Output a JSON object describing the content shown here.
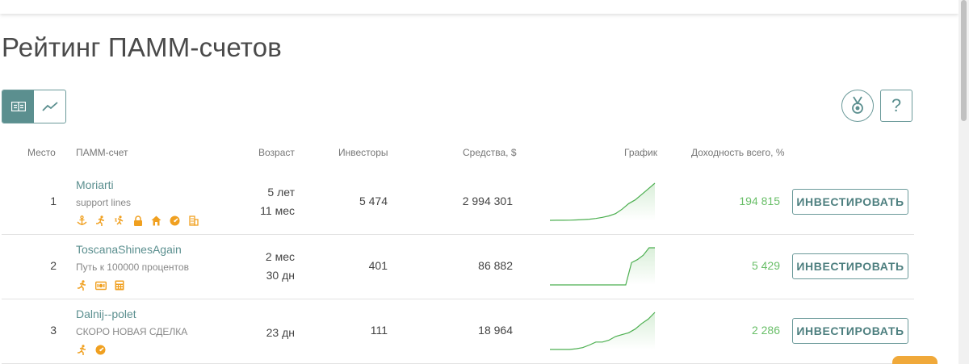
{
  "page": {
    "title": "Рейтинг ПАММ-счетов"
  },
  "controls": {
    "table_view_icon": "table-icon",
    "chart_view_icon": "trend-chart-icon",
    "medal_icon": "medal-icon",
    "help_label": "?"
  },
  "table": {
    "headers": {
      "rank": "Место",
      "account": "ПАММ-счет",
      "age": "Возраст",
      "investors": "Инвесторы",
      "funds": "Средства, $",
      "chart": "График",
      "yield": "Доходность всего, %"
    },
    "rows": [
      {
        "rank": "1",
        "name": "Moriarti",
        "subtitle": "support lines",
        "age_line1": "5 лет",
        "age_line2": "11 мес",
        "investors": "5 474",
        "funds": "2 994 301",
        "yield": "194 815",
        "invest_label": "ИНВЕСТИРОВАТЬ",
        "icons": [
          "anchor-icon",
          "runner-icon",
          "lightning-runner-icon",
          "lock-icon",
          "home-icon",
          "speedometer-icon",
          "coins-icon"
        ],
        "spark": [
          0,
          0.2,
          0.3,
          0.5,
          1,
          2,
          3,
          5,
          8,
          12,
          18,
          30,
          45,
          55,
          70,
          85,
          100
        ]
      },
      {
        "rank": "2",
        "name": "ToscanaShinesAgain",
        "subtitle": "Путь к 100000 процентов",
        "age_line1": "2 мес",
        "age_line2": "30 дн",
        "investors": "401",
        "funds": "86 882",
        "yield": "5 429",
        "invest_label": "ИНВЕСТИРОВАТЬ",
        "icons": [
          "runner-icon",
          "cash-icon",
          "calculator-icon"
        ],
        "spark": [
          0,
          0,
          0,
          0,
          0,
          0,
          0,
          0,
          0,
          0,
          0,
          0,
          0,
          0,
          60,
          68,
          80,
          100,
          100
        ]
      },
      {
        "rank": "3",
        "name": "Dalnij--polet",
        "subtitle": "СКОРО НОВАЯ СДЕЛКА",
        "age_line1": "23 дн",
        "age_line2": "",
        "investors": "111",
        "funds": "18 964",
        "yield": "2 286",
        "invest_label": "ИНВЕСТИРОВАТЬ",
        "icons": [
          "runner-icon",
          "speedometer-icon"
        ],
        "spark": [
          0,
          0,
          0,
          0,
          2,
          5,
          12,
          20,
          20,
          25,
          35,
          40,
          45,
          55,
          70,
          82,
          100
        ]
      }
    ]
  }
}
